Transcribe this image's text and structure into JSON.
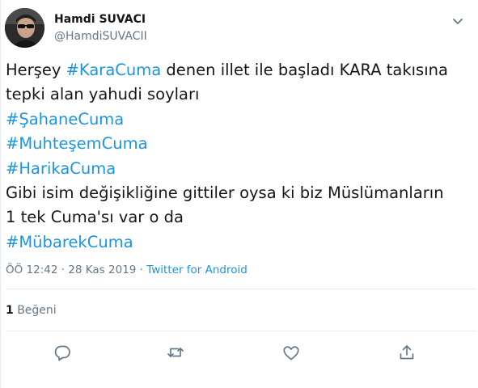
{
  "user": {
    "name": "Hamdi SUVACI",
    "handle": "@HamdiSUVACII"
  },
  "tweet": {
    "lines": [
      [
        {
          "text": "Herşey "
        },
        {
          "text": "#KaraCuma",
          "hashtag": true
        },
        {
          "text": " denen illet ile başladı KARA takısına"
        }
      ],
      [
        {
          "text": "tepki alan yahudi soyları"
        }
      ],
      [
        {
          "text": "#ŞahaneCuma",
          "hashtag": true
        }
      ],
      [
        {
          "text": "#MuhteşemCuma",
          "hashtag": true
        }
      ],
      [
        {
          "text": "#HarikaCuma",
          "hashtag": true
        }
      ],
      [
        {
          "text": "Gibi isim değişikliğine gittiler oysa ki biz Müslümanların"
        }
      ],
      [
        {
          "text": "1 tek Cuma's"
        },
        {
          "text": "ı var o da"
        }
      ],
      [
        {
          "text": "#MübarekCuma",
          "hashtag": true
        }
      ]
    ]
  },
  "meta": {
    "time": "ÖÖ 12:42",
    "separator1": " · ",
    "date": "28 Kas 2019",
    "separator2": " · ",
    "source": "Twitter for Android"
  },
  "likes": {
    "count": "1",
    "label": " Beğeni"
  },
  "icons": {
    "reply": "reply-icon",
    "retweet": "retweet-icon",
    "like": "heart-icon",
    "share": "share-icon",
    "caret": "chevron-down-icon"
  },
  "colors": {
    "hashtag": "#1b95e0",
    "muted": "#657786",
    "text": "#14171a",
    "border": "#e6ecf0"
  }
}
